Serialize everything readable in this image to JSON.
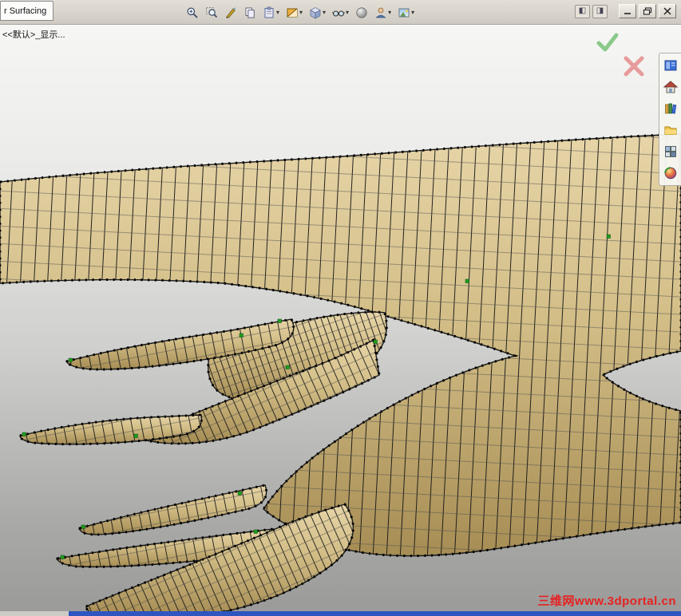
{
  "window": {
    "tab_title": "r Surfacing",
    "dock_left_glyph": "◧",
    "dock_right_glyph": "◨",
    "controls": [
      "minimize",
      "restore",
      "close"
    ]
  },
  "toolbar": {
    "dropdown_glyph": "▾",
    "icons": [
      {
        "name": "zoom-to-fit-icon"
      },
      {
        "name": "zoom-to-area-icon"
      },
      {
        "name": "sketch-pen-icon"
      },
      {
        "name": "copy-icon"
      },
      {
        "name": "paste-icon",
        "dropdown": true
      },
      {
        "name": "section-view-icon",
        "dropdown": true
      },
      {
        "name": "view-orientation-icon",
        "dropdown": true
      },
      {
        "name": "display-style-icon",
        "dropdown": true
      },
      {
        "name": "shaded-sphere-icon"
      },
      {
        "name": "edit-appearance-icon",
        "dropdown": true
      },
      {
        "name": "apply-scene-icon",
        "dropdown": true
      }
    ]
  },
  "feature_tree": {
    "label": "<<默认>_显示..."
  },
  "confirmation_corner": {
    "accept_color": "#8bc98b",
    "cancel_color": "#e79b9b"
  },
  "task_pane": {
    "icons": [
      {
        "name": "task-pane-panel-icon"
      },
      {
        "name": "solidworks-resources-home-icon"
      },
      {
        "name": "design-library-icon"
      },
      {
        "name": "file-explorer-folder-icon"
      },
      {
        "name": "view-palette-icon"
      },
      {
        "name": "appearances-sphere-icon"
      }
    ]
  },
  "viewport": {
    "watermark": "三维网www.3dportal.cn"
  },
  "model": {
    "surface_color": "#cdb87f",
    "edge_color": "#161616",
    "control_point_color": "#000000",
    "highlight_point_color": "#1f9e1f"
  }
}
